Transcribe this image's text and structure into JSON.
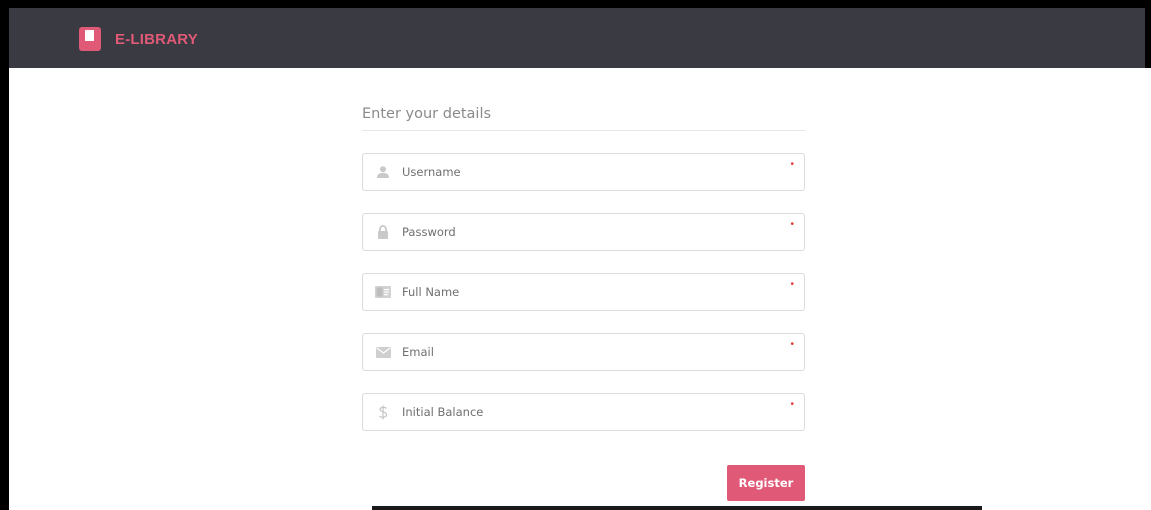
{
  "app": {
    "brand": "E-LIBRARY",
    "brand_color": "#e05a77",
    "navbar_color": "#393a42",
    "brand_icon": "book-icon"
  },
  "form": {
    "title": "Enter your details",
    "required_mark": "•",
    "fields": [
      {
        "icon": "user-icon",
        "placeholder": "Username",
        "value": ""
      },
      {
        "icon": "lock-icon",
        "placeholder": "Password",
        "value": ""
      },
      {
        "icon": "id-card-icon",
        "placeholder": "Full Name",
        "value": ""
      },
      {
        "icon": "envelope-icon",
        "placeholder": "Email",
        "value": ""
      },
      {
        "icon": "dollar-icon",
        "placeholder": "Initial Balance",
        "value": ""
      }
    ],
    "submit_label": "Register"
  }
}
